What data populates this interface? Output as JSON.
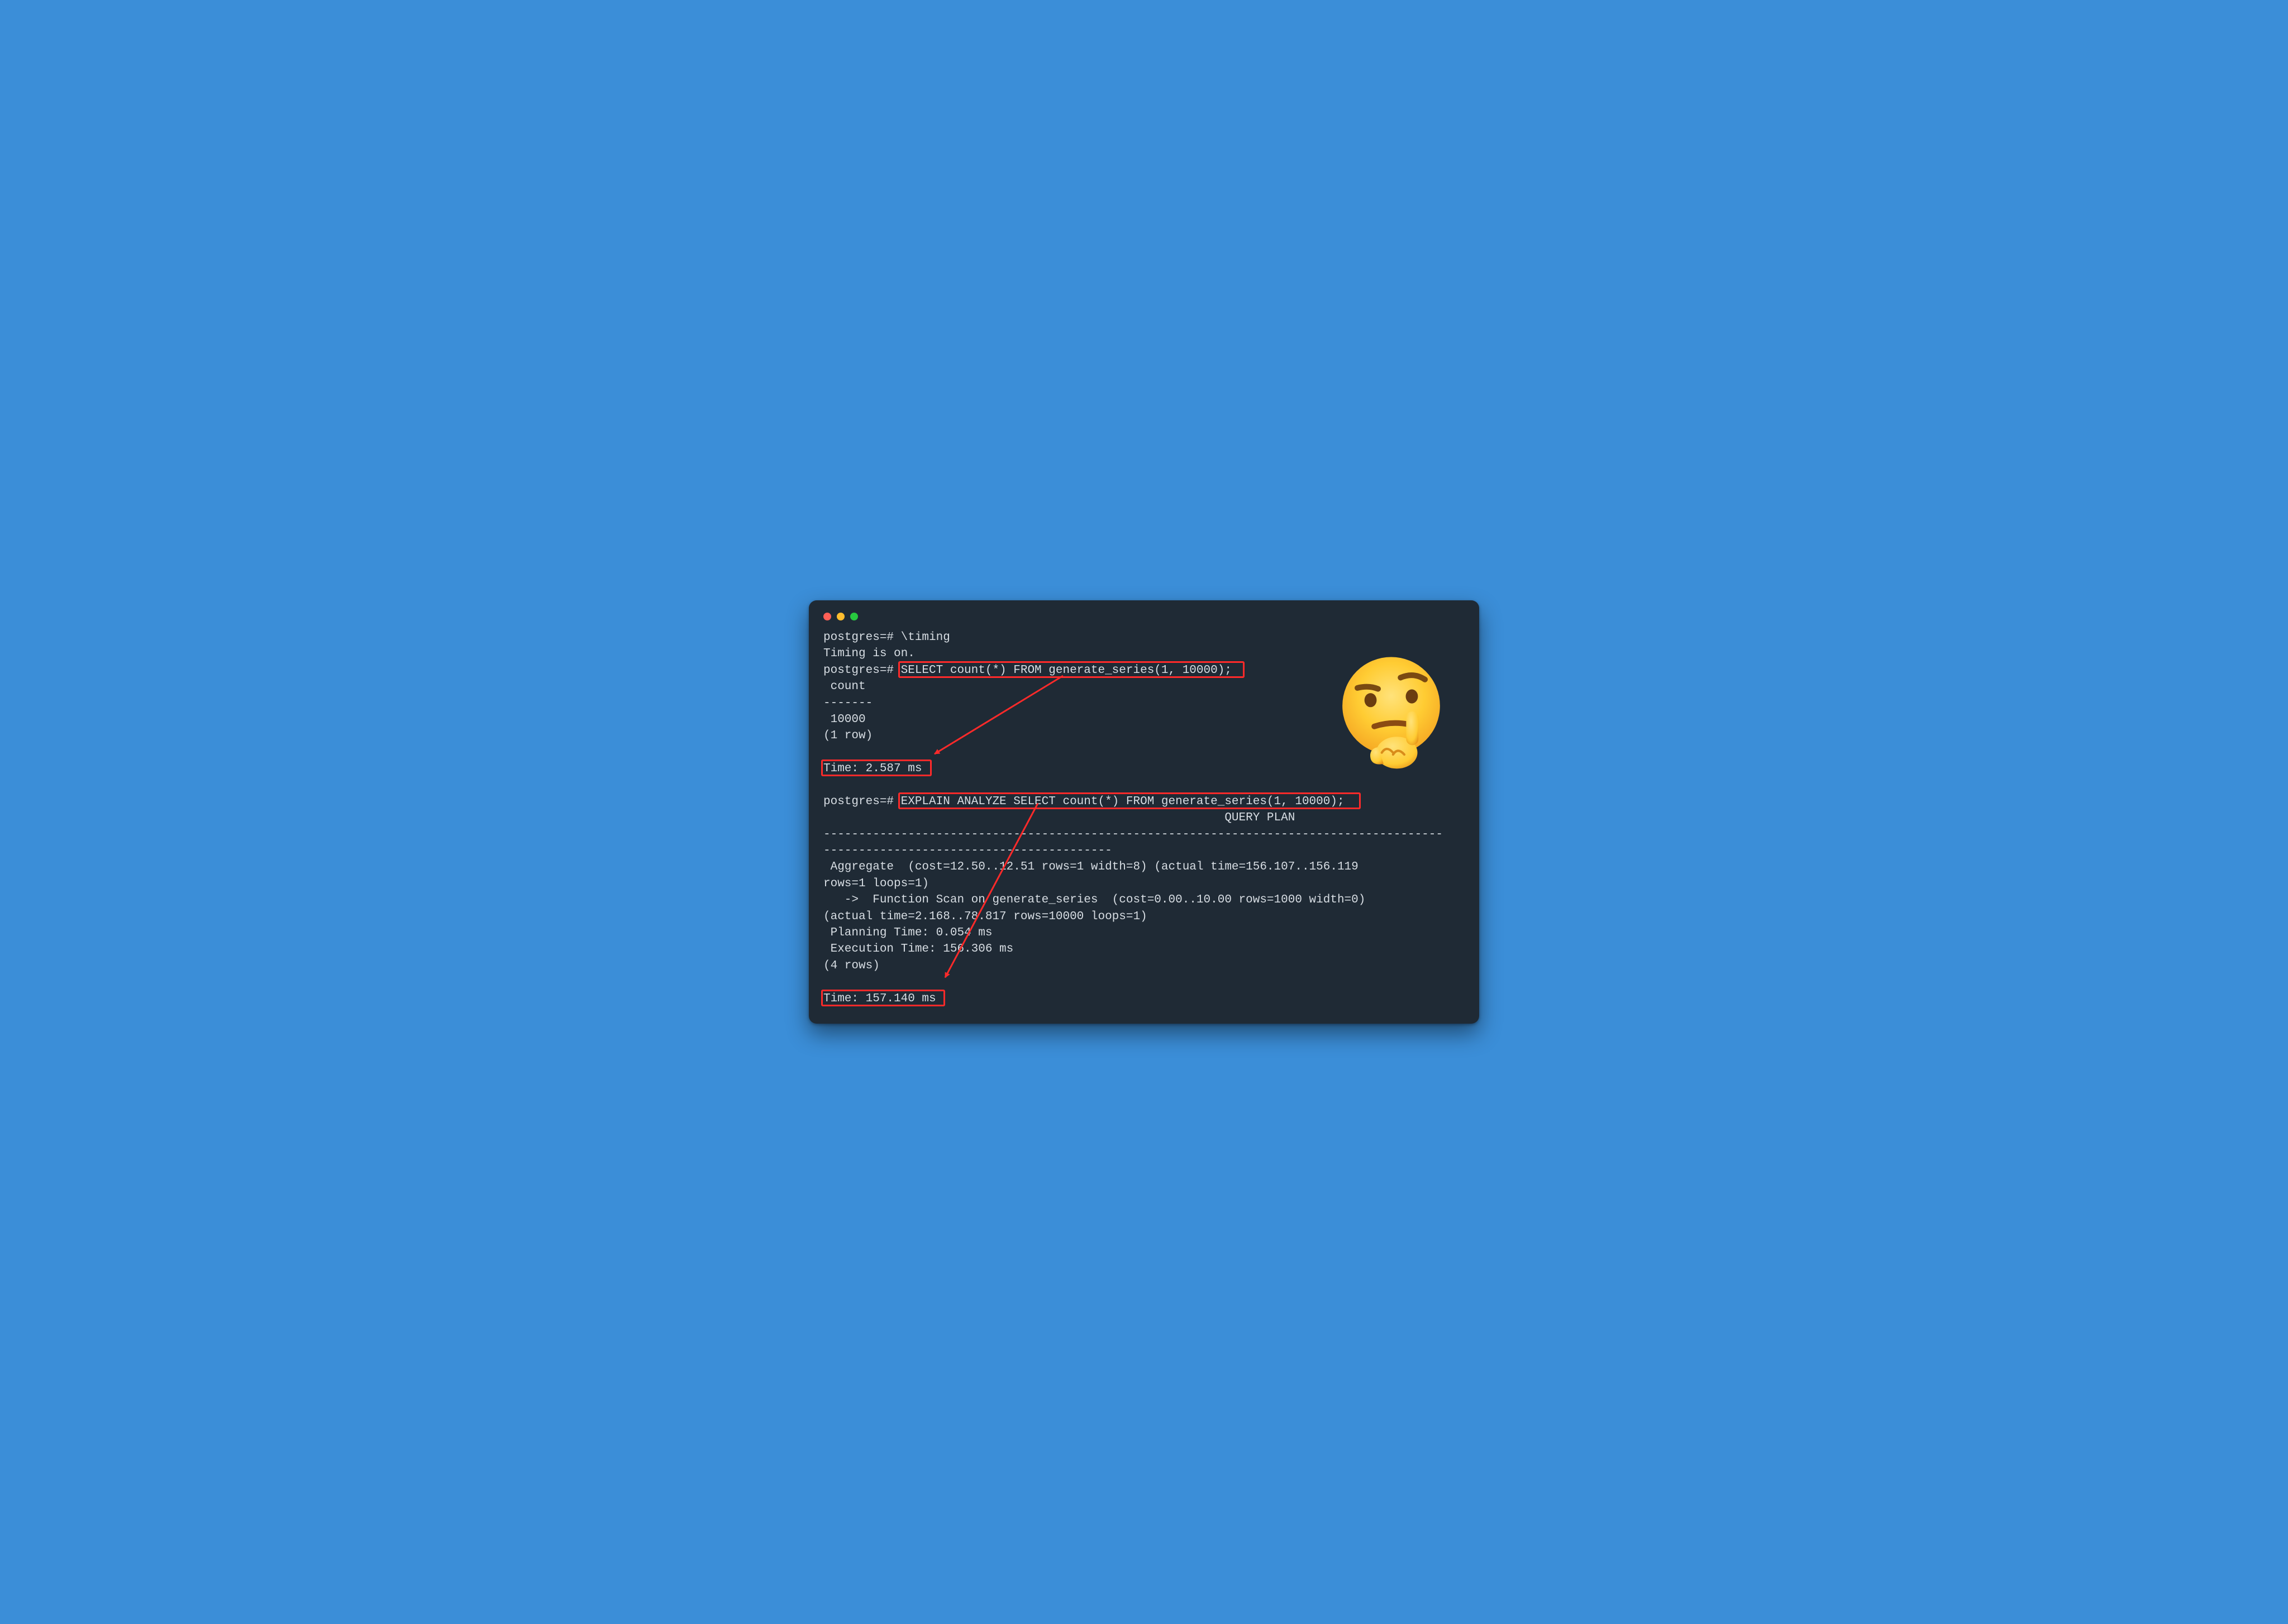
{
  "terminal": {
    "lines": [
      "postgres=# \\timing",
      "Timing is on.",
      "postgres=# SELECT count(*) FROM generate_series(1, 10000);",
      " count ",
      "-------",
      " 10000",
      "(1 row)",
      "",
      "Time: 2.587 ms",
      "",
      "postgres=# EXPLAIN ANALYZE SELECT count(*) FROM generate_series(1, 10000);",
      "                                                         QUERY PLAN                     ",
      "----------------------------------------------------------------------------------------",
      "-----------------------------------------",
      " Aggregate  (cost=12.50..12.51 rows=1 width=8) (actual time=156.107..156.119 ",
      "rows=1 loops=1)",
      "   ->  Function Scan on generate_series  (cost=0.00..10.00 rows=1000 width=0) ",
      "(actual time=2.168..78.817 rows=10000 loops=1)",
      " Planning Time: 0.054 ms",
      " Execution Time: 156.306 ms",
      "(4 rows)",
      "",
      "Time: 157.140 ms"
    ]
  },
  "highlights": {
    "q1": "SELECT count(*) FROM generate_series(1, 10000);",
    "t1": "Time: 2.587 ms",
    "q2": "EXPLAIN ANALYZE SELECT count(*) FROM generate_series(1, 10000);",
    "t2": "Time: 157.140 ms"
  },
  "colors": {
    "bg": "#3b8ed8",
    "term_bg": "#1f2a35",
    "term_fg": "#d7dde3",
    "highlight": "#ff2a2a"
  },
  "emoji_name": "thinking-face"
}
